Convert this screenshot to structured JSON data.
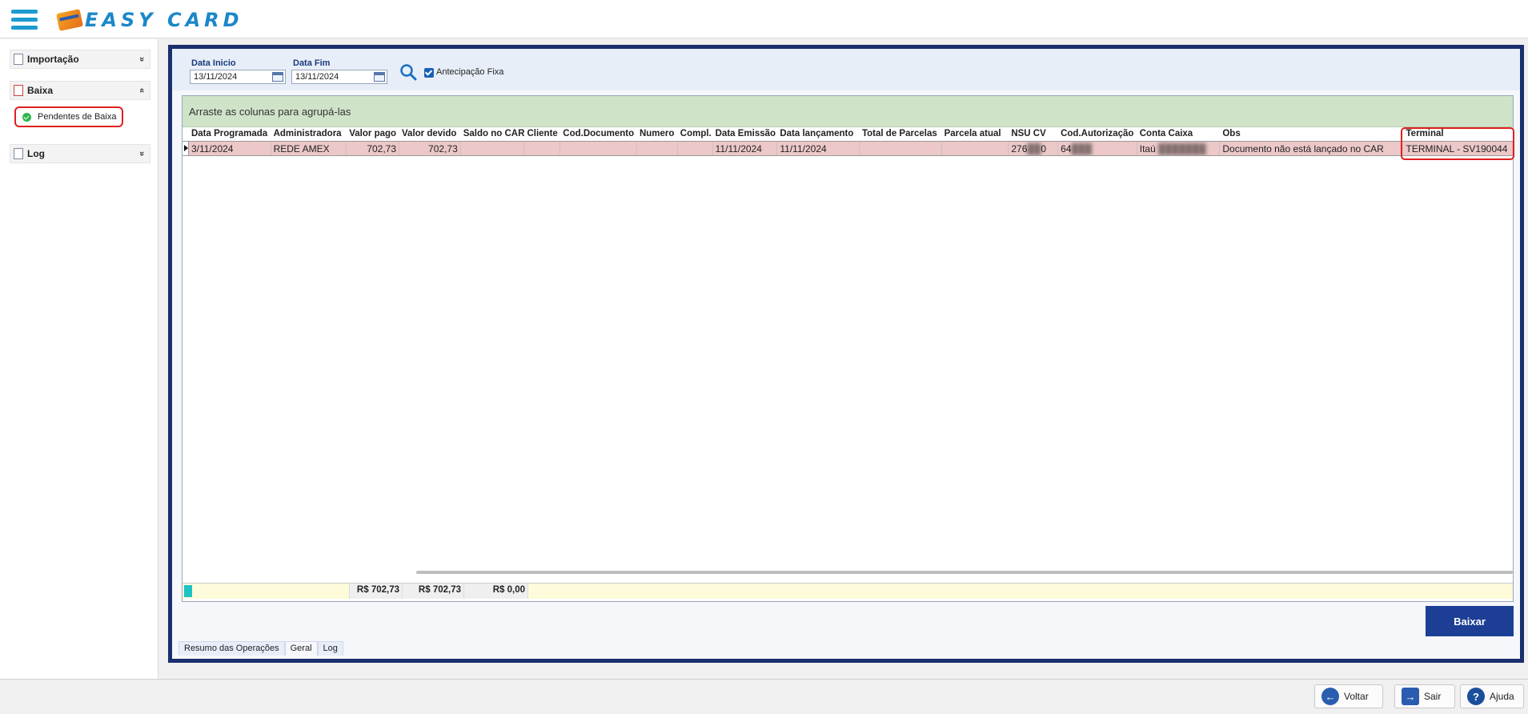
{
  "app": {
    "logo_text": "EASY CARD"
  },
  "sidebar": {
    "sections": [
      {
        "label": "Importação",
        "chevron": "»"
      },
      {
        "label": "Baixa",
        "chevron": "«"
      },
      {
        "label": "Log",
        "chevron": "»"
      }
    ],
    "pendentes_label": "Pendentes de Baixa"
  },
  "filters": {
    "data_inicio_label": "Data Inicio",
    "data_inicio_value": "13/11/2024",
    "data_fim_label": "Data Fim",
    "data_fim_value": "13/11/2024",
    "antecipacao_label": "Antecipação Fixa"
  },
  "grid": {
    "group_hint": "Arraste as colunas para agrupá-las",
    "columns": [
      "Data Programada",
      "Administradora",
      "Valor pago",
      "Valor devido",
      "Saldo no CAR",
      "Cliente",
      "Cod.Documento",
      "Numero",
      "Compl.",
      "Data Emissão",
      "Data lançamento",
      "Total de Parcelas",
      "Parcela atual",
      "NSU CV",
      "Cod.Autorização",
      "Conta Caixa",
      "Obs",
      "Terminal"
    ],
    "row": {
      "data_programada": "3/11/2024",
      "administradora": "REDE AMEX",
      "valor_pago": "702,73",
      "valor_devido": "702,73",
      "saldo_car": "",
      "cliente": "",
      "cod_documento": "",
      "numero": "",
      "compl": "",
      "data_emissao": "11/11/2024",
      "data_lancamento": "11/11/2024",
      "total_parcelas": "",
      "parcela_atual": "",
      "nsu_cv_prefix": "276",
      "nsu_cv_suffix": "0",
      "cod_autorizacao_prefix": "64",
      "conta_caixa_prefix": "Itaú",
      "obs": "Documento não está lançado no CAR",
      "terminal": "TERMINAL - SV190044"
    },
    "footer": {
      "valor_pago": "R$ 702,73",
      "valor_devido": "R$ 702,73",
      "saldo_car": "R$ 0,00"
    }
  },
  "actions": {
    "baixar": "Baixar"
  },
  "tabs": [
    "Resumo das Operações",
    "Geral",
    "Log"
  ],
  "bottom": {
    "voltar": "Voltar",
    "sair": "Sair",
    "ajuda": "Ajuda"
  },
  "colors": {
    "accent": "#1c3f95",
    "frame": "#1a2f6e",
    "row_highlight": "#ecc8c8",
    "group_panel": "#cfe3c9",
    "footer": "#fdfbd9"
  }
}
